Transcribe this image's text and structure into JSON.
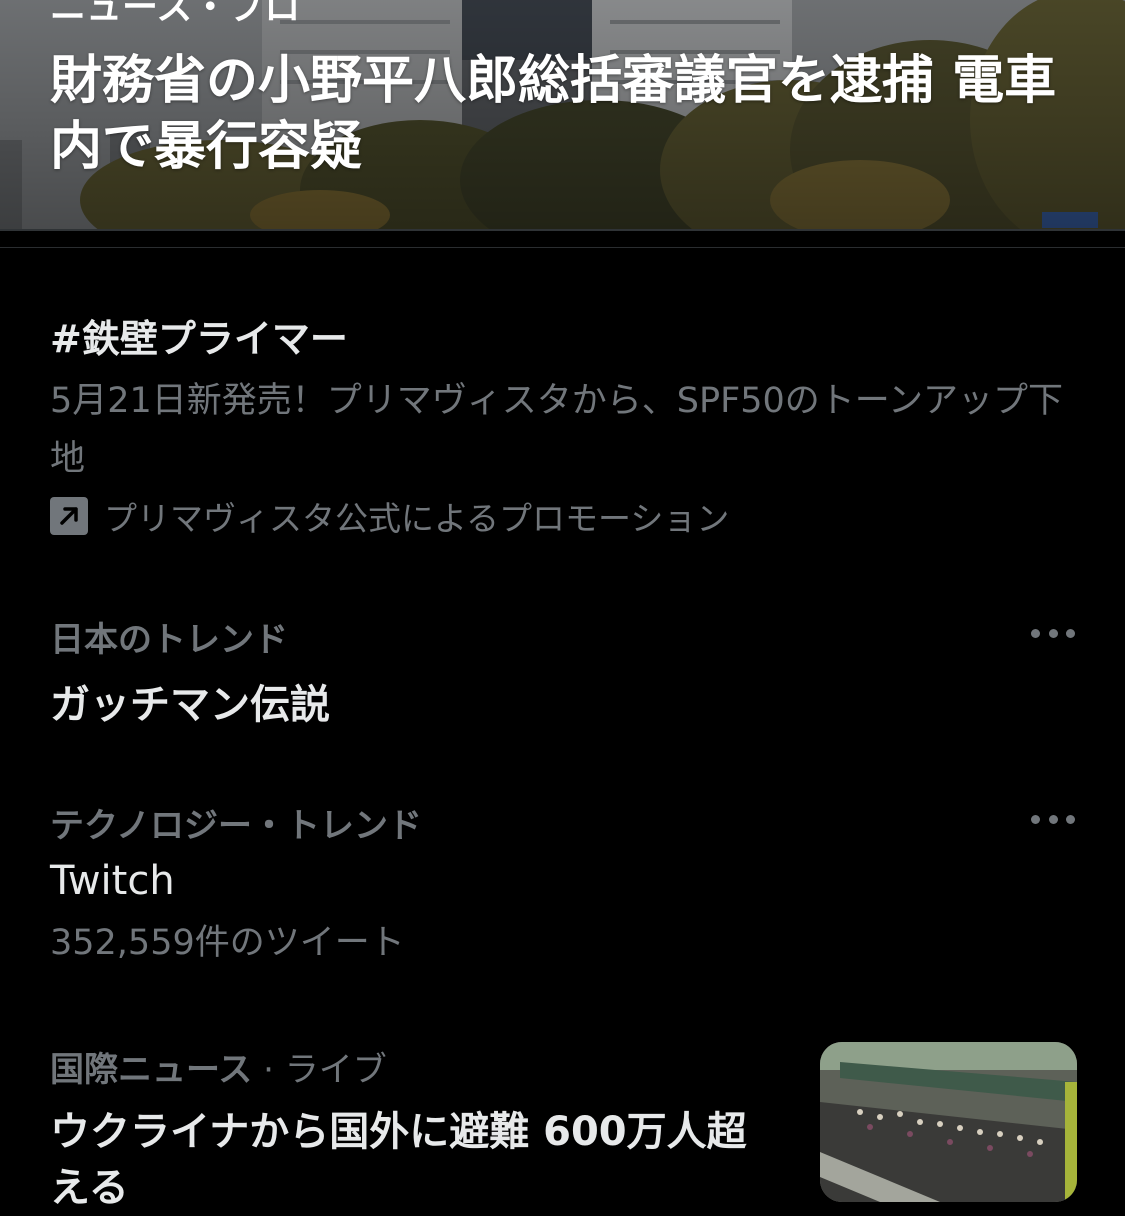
{
  "hero": {
    "kicker": "ニュース・プロ",
    "title": "財務省の小野平八郎総括審議官を逮捕 電車内で暴行容疑"
  },
  "promo": {
    "hashtag": "#鉄壁プライマー",
    "description": "5月21日新発売！プリマヴィスタから、SPF50のトーンアップ下地",
    "promoted_by": "プリマヴィスタ公式によるプロモーション"
  },
  "trends": [
    {
      "category": "日本のトレンド",
      "title": "ガッチマン伝説"
    },
    {
      "category": "テクノロジー・トレンド",
      "title": "Twitch",
      "count": "352,559件のツイート"
    }
  ],
  "news": {
    "category": "国際ニュース",
    "separator": " · ",
    "status": "ライブ",
    "title": "ウクライナから国外に避難 600万人超える"
  },
  "icons": {
    "promoted": "promoted-arrow-icon",
    "more": "more-dots-icon"
  },
  "colors": {
    "background": "#000000",
    "primary_text": "#e7e9ea",
    "secondary_text": "#71767b"
  }
}
